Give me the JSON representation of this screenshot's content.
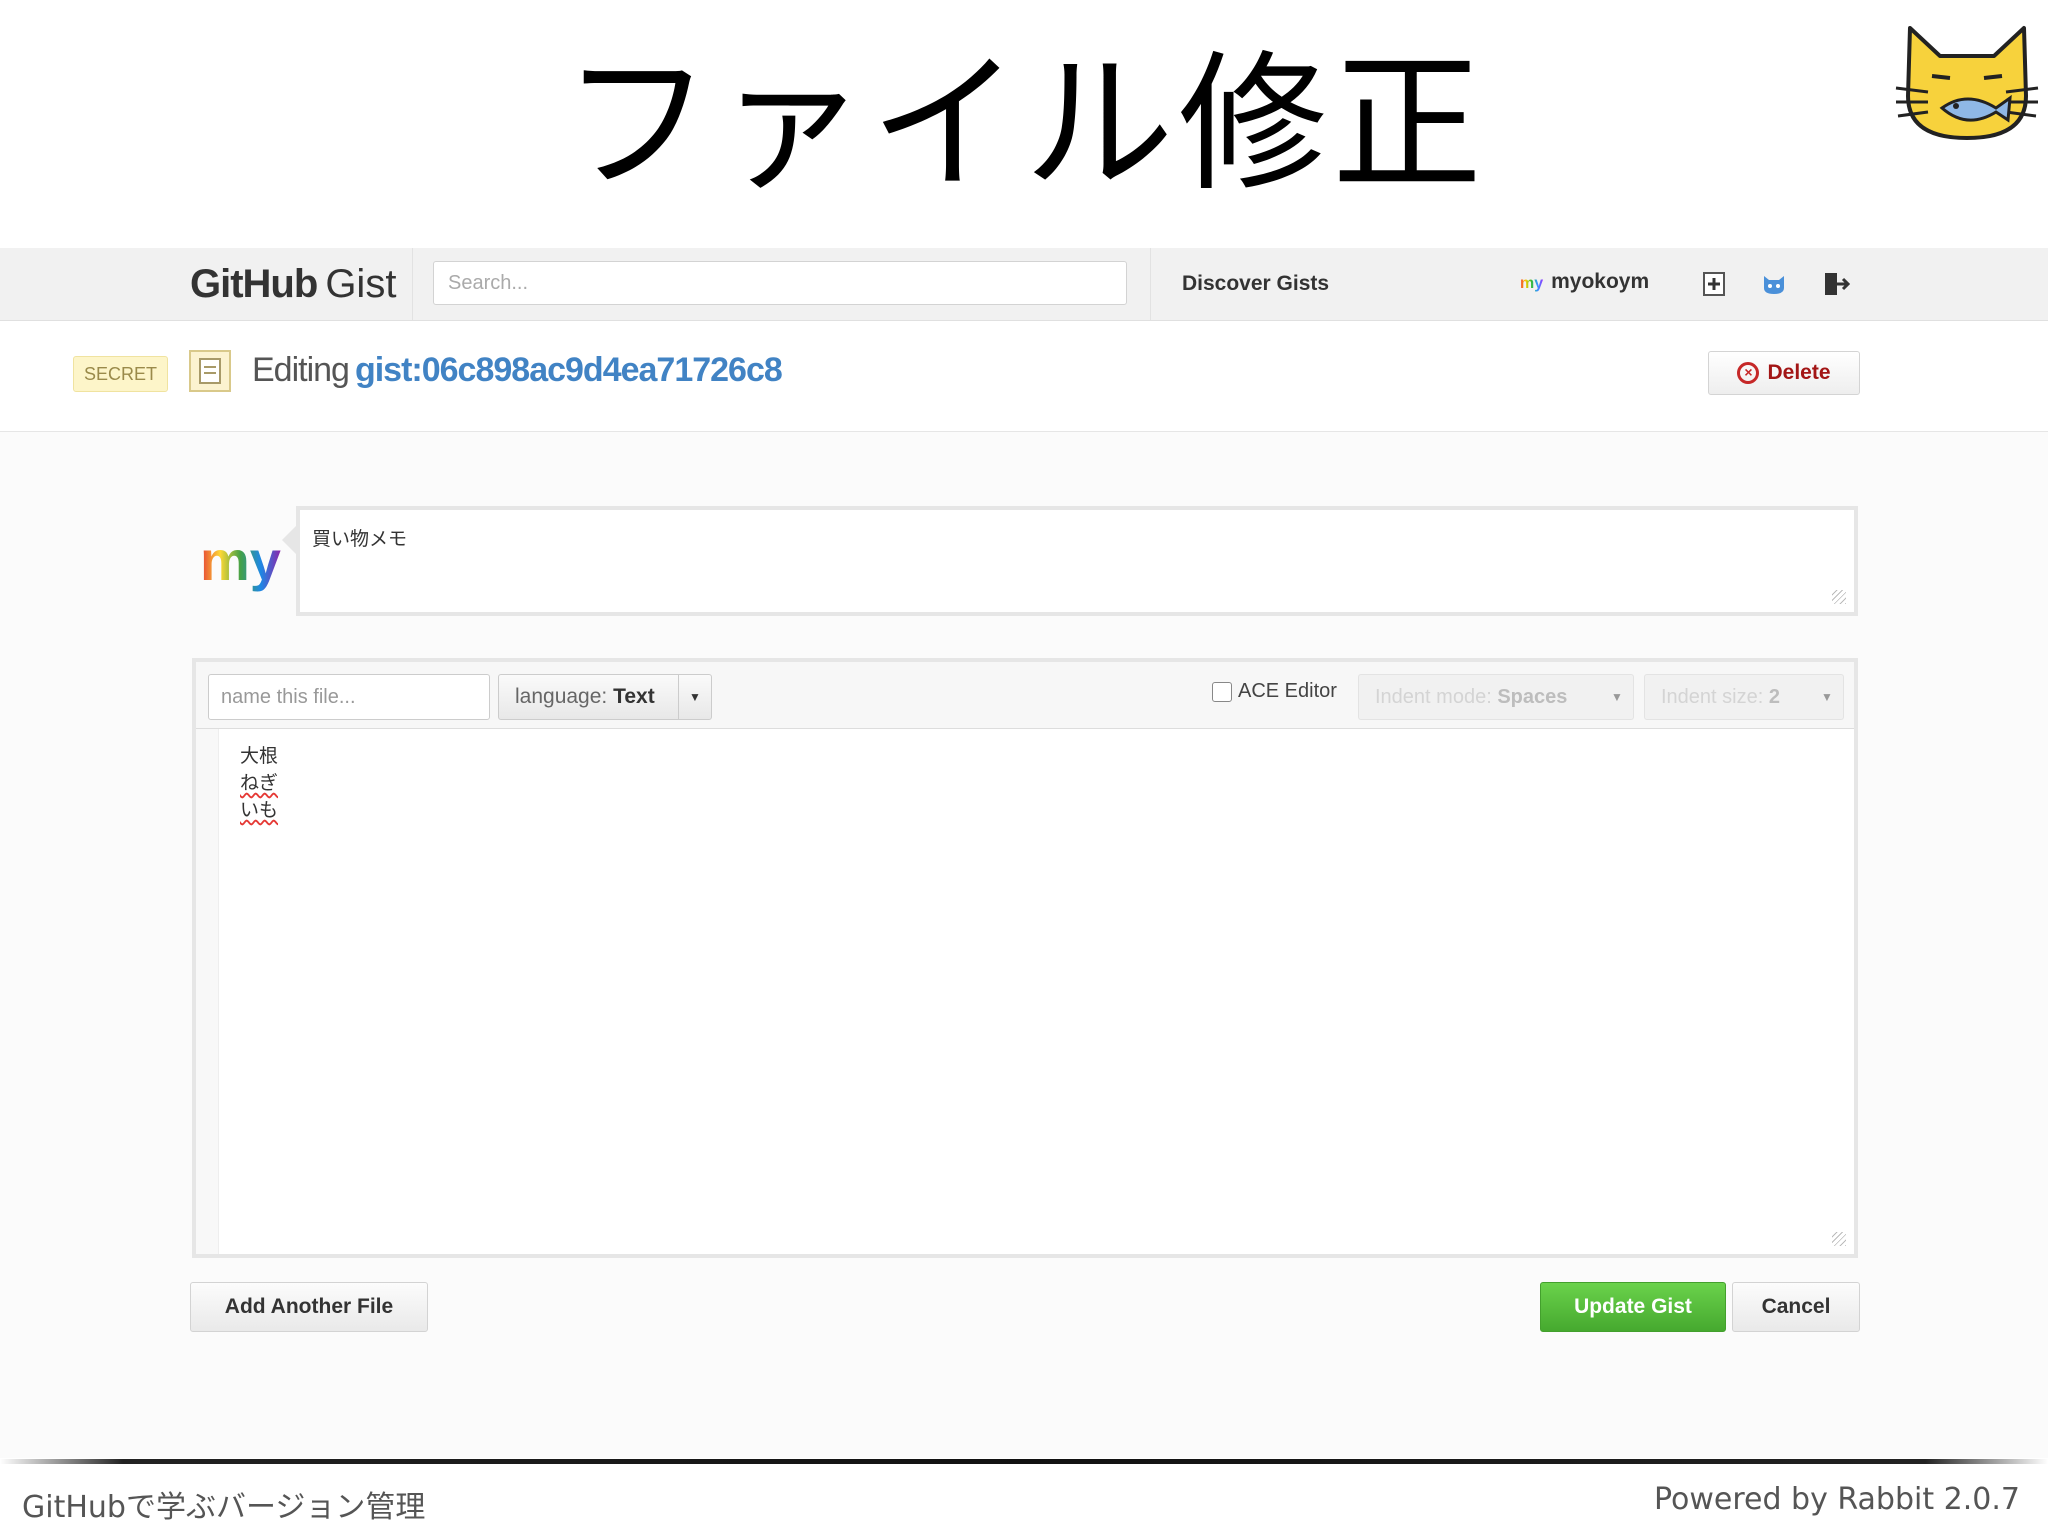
{
  "slide": {
    "title": "ファイル修正",
    "footer_left": "GitHubで学ぶバージョン管理",
    "footer_right": "Powered by Rabbit 2.0.7"
  },
  "topbar": {
    "logo_bold": "GitHub",
    "logo_light": "Gist",
    "search_placeholder": "Search...",
    "discover": "Discover Gists",
    "user_avatar_text": "my",
    "username": "myokoym",
    "icons": [
      "new-gist-icon",
      "octocat-icon",
      "sign-out-icon"
    ]
  },
  "header": {
    "badge": "SECRET",
    "editing_label": "Editing",
    "gist_id": "gist:06c898ac9d4ea71726c8",
    "delete_label": "Delete"
  },
  "description": {
    "avatar_text": "my",
    "value": "買い物メモ"
  },
  "file": {
    "name_placeholder": "name this file...",
    "language_label": "language:",
    "language_value": "Text",
    "ace_label": "ACE Editor",
    "ace_checked": false,
    "indent_mode_label": "Indent mode:",
    "indent_mode_value": "Spaces",
    "indent_size_label": "Indent size:",
    "indent_size_value": "2",
    "lines": [
      "大根",
      "ねぎ",
      "いも"
    ]
  },
  "actions": {
    "add_file": "Add Another File",
    "update": "Update Gist",
    "cancel": "Cancel"
  },
  "colors": {
    "link": "#4183c4",
    "update_button": "#55b93b",
    "delete_text": "#a31616"
  }
}
